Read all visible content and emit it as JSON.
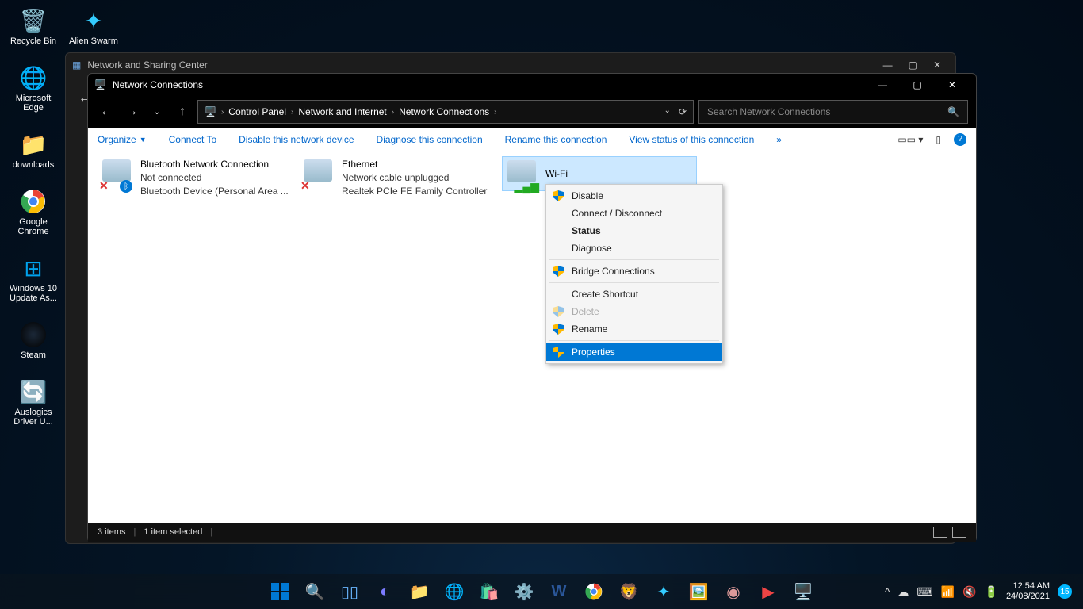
{
  "desktop": {
    "icons": [
      {
        "label": "Recycle Bin",
        "glyph": "🗑️"
      },
      {
        "label": "Microsoft Edge",
        "glyph": "🌐"
      },
      {
        "label": "downloads",
        "glyph": "📁"
      },
      {
        "label": "Google Chrome",
        "glyph": "◯"
      },
      {
        "label": "Windows 10 Update As...",
        "glyph": "⊞"
      },
      {
        "label": "Steam",
        "glyph": "⚙"
      },
      {
        "label": "Auslogics Driver U...",
        "glyph": "🔄"
      }
    ],
    "row2_icon": {
      "label": "Alien Swarm",
      "glyph": "✦"
    }
  },
  "bg_window": {
    "title": "Network and Sharing Center"
  },
  "fg_window": {
    "title": "Network Connections",
    "breadcrumb": [
      "Control Panel",
      "Network and Internet",
      "Network Connections"
    ],
    "search_placeholder": "Search Network Connections",
    "toolbar": {
      "organize": "Organize",
      "items": [
        "Connect To",
        "Disable this network device",
        "Diagnose this connection",
        "Rename this connection",
        "View status of this connection"
      ],
      "overflow": "»"
    },
    "adapters": [
      {
        "name": "Bluetooth Network Connection",
        "status": "Not connected",
        "device": "Bluetooth Device (Personal Area ..."
      },
      {
        "name": "Ethernet",
        "status": "Network cable unplugged",
        "device": "Realtek PCIe FE Family Controller"
      },
      {
        "name": "Wi-Fi"
      }
    ],
    "statusbar": {
      "count": "3 items",
      "selected": "1 item selected"
    }
  },
  "context_menu": {
    "items": [
      {
        "label": "Disable",
        "shield": true
      },
      {
        "label": "Connect / Disconnect"
      },
      {
        "label": "Status",
        "bold": true
      },
      {
        "label": "Diagnose"
      },
      {
        "sep": true
      },
      {
        "label": "Bridge Connections",
        "shield": true
      },
      {
        "sep": true
      },
      {
        "label": "Create Shortcut"
      },
      {
        "label": "Delete",
        "shield": true,
        "disabled": true
      },
      {
        "label": "Rename",
        "shield": true
      },
      {
        "sep": true
      },
      {
        "label": "Properties",
        "shield": true,
        "selected": true
      }
    ]
  },
  "taskbar": {
    "time": "12:54 AM",
    "date": "24/08/2021",
    "badge": "15"
  }
}
